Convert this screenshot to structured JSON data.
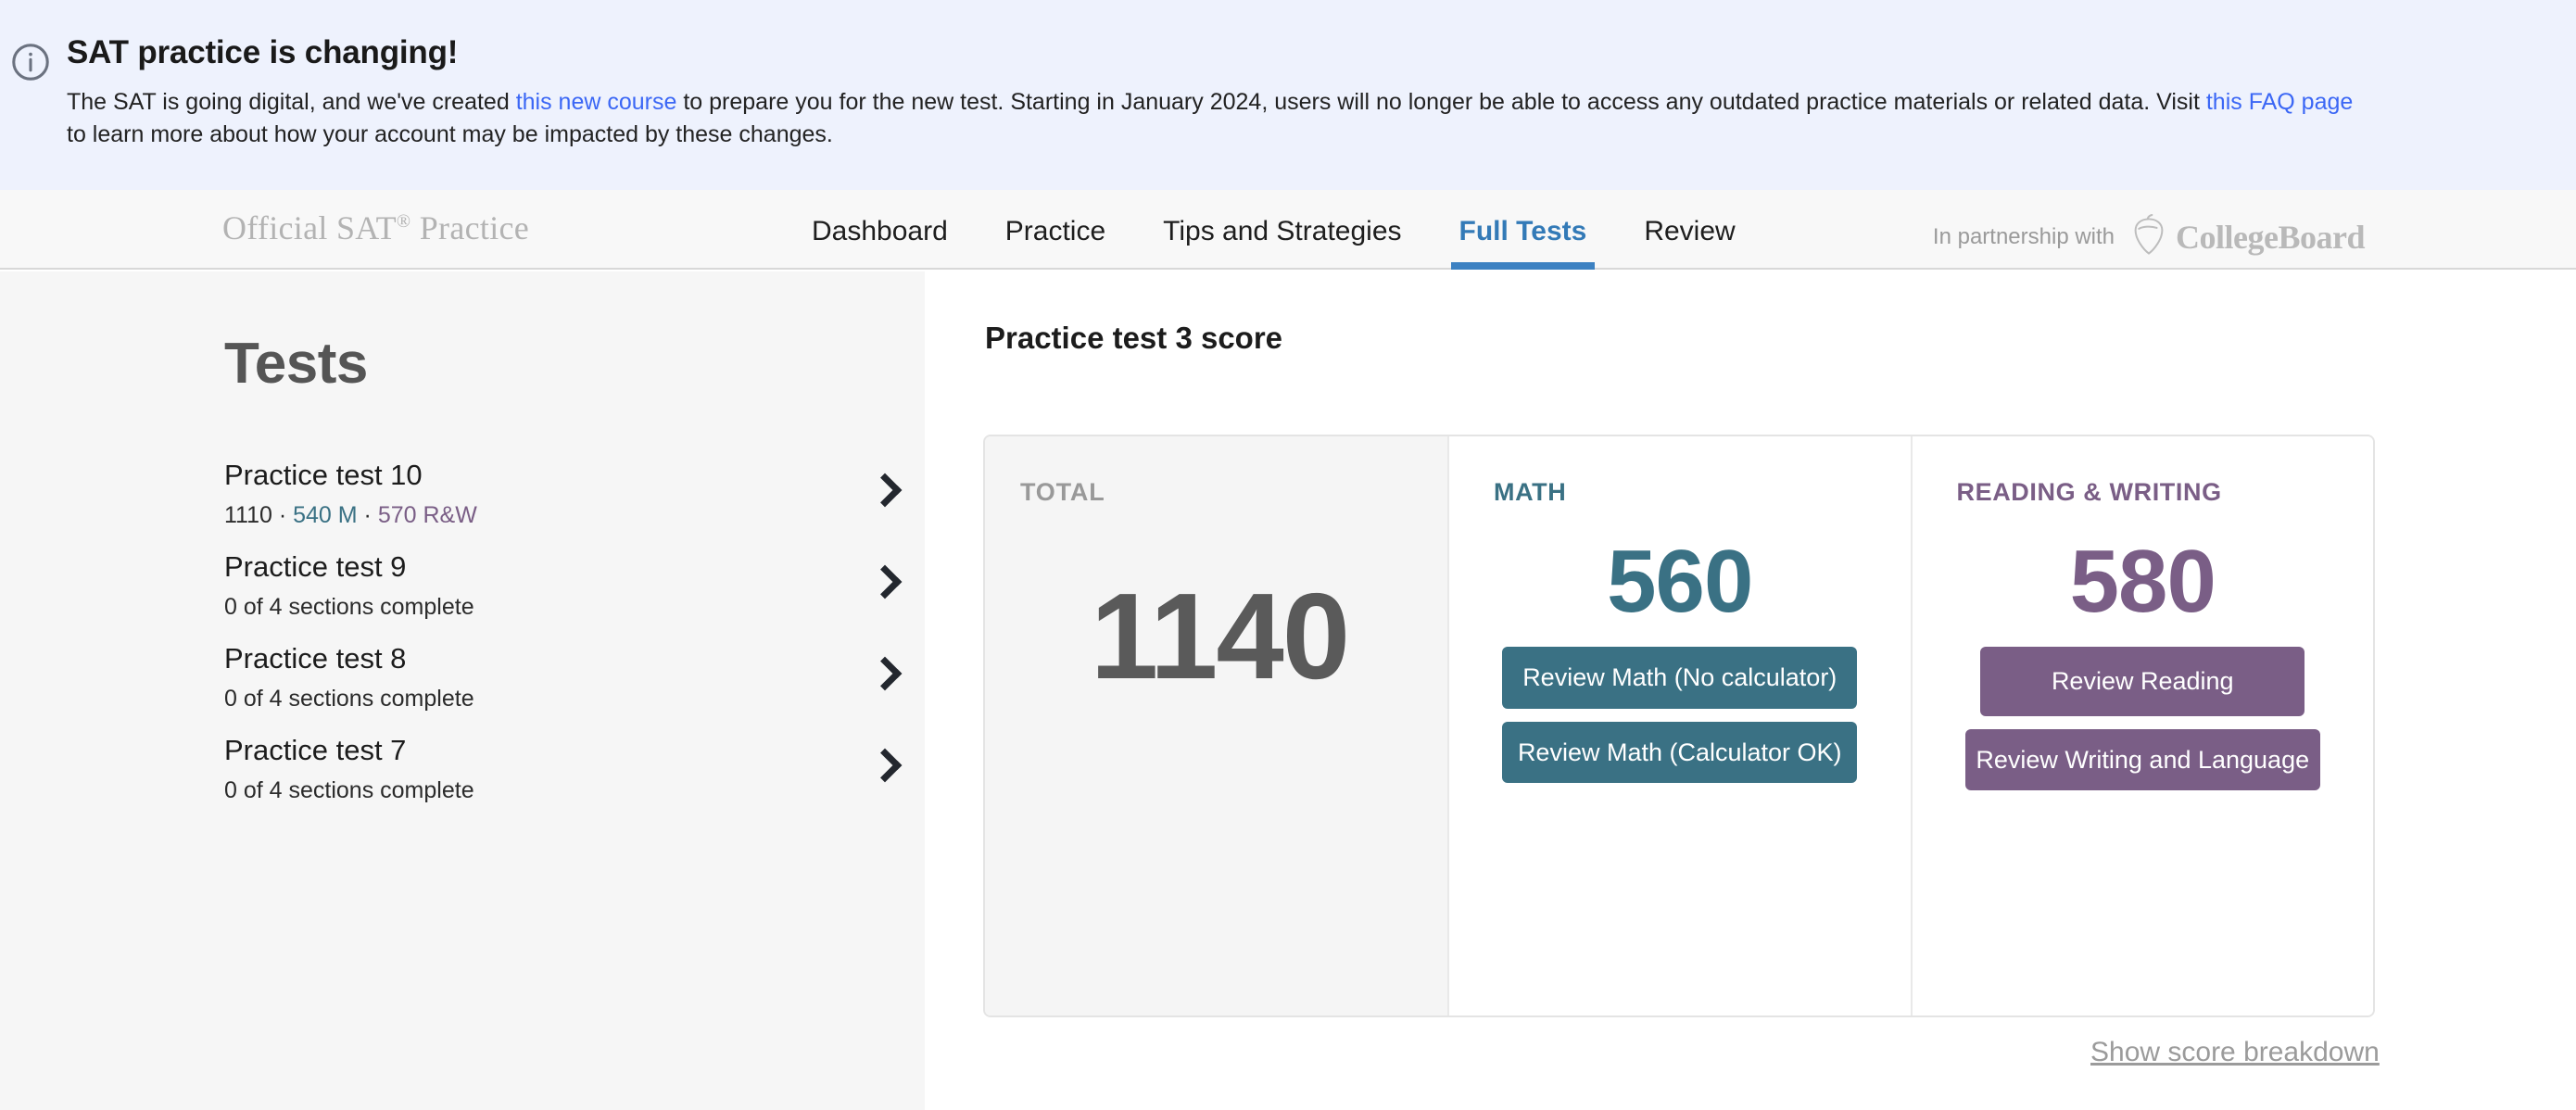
{
  "banner": {
    "icon": "info-circle-icon",
    "title": "SAT practice is changing!",
    "text_part1": "The SAT is going digital, and we've created ",
    "link1": "this new course",
    "text_part2": " to prepare you for the new test. Starting in January 2024, users will no longer be able to access any outdated practice materials or related data. Visit ",
    "link2": "this FAQ page",
    "text_part3": "to learn more about how your account may be impacted by these changes.",
    "background_color": "#eef2fd",
    "link_color": "#3b67f5"
  },
  "nav": {
    "brand": "Official SAT",
    "brand_sup": "®",
    "brand_suffix": " Practice",
    "items": [
      {
        "label": "Dashboard",
        "active": false
      },
      {
        "label": "Practice",
        "active": false
      },
      {
        "label": "Tips and Strategies",
        "active": false
      },
      {
        "label": "Full Tests",
        "active": true
      },
      {
        "label": "Review",
        "active": false
      }
    ],
    "partner_label": "In partnership with",
    "partner_name": "CollegeBoard",
    "active_color": "#337ab7"
  },
  "sidebar": {
    "title": "Tests",
    "tests": [
      {
        "name": "Practice test 10",
        "total": "1110",
        "math": "540 M",
        "rw": "570 R&W",
        "sep": " · ",
        "status": ""
      },
      {
        "name": "Practice test 9",
        "status": "0 of 4 sections complete"
      },
      {
        "name": "Practice test 8",
        "status": "0 of 4 sections complete"
      },
      {
        "name": "Practice test 7",
        "status": "0 of 4 sections complete"
      }
    ]
  },
  "main": {
    "heading": "Practice test 3 score",
    "total": {
      "label": "TOTAL",
      "value": "1140"
    },
    "math": {
      "label": "MATH",
      "value": "560",
      "color": "#3a7184",
      "button_no_calc": "Review Math (No calculator)",
      "button_calc": "Review Math (Calculator OK)"
    },
    "reading_writing": {
      "label": "READING & WRITING",
      "value": "580",
      "color": "#7a5e86",
      "button_reading": "Review Reading",
      "button_writing": "Review Writing and Language"
    },
    "breakdown_link": "Show score breakdown"
  }
}
